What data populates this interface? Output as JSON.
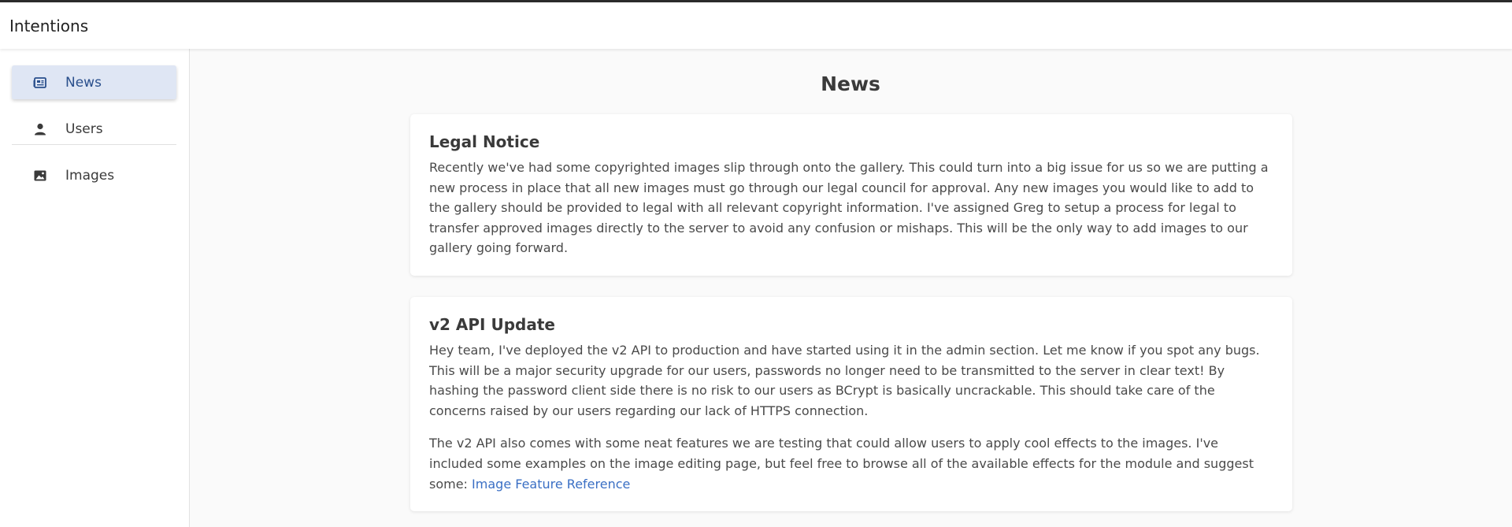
{
  "app": {
    "title": "Intentions"
  },
  "sidebar": {
    "items": [
      {
        "label": "News",
        "icon": "newspaper-icon",
        "active": true
      },
      {
        "label": "Users",
        "icon": "user-icon",
        "active": false
      },
      {
        "label": "Images",
        "icon": "image-icon",
        "active": false
      }
    ]
  },
  "main": {
    "title": "News",
    "cards": [
      {
        "title": "Legal Notice",
        "body": "Recently we've had some copyrighted images slip through onto the gallery. This could turn into a big issue for us so we are putting a new process in place that all new images must go through our legal council for approval. Any new images you would like to add to the gallery should be provided to legal with all relevant copyright information. I've assigned Greg to setup a process for legal to transfer approved images directly to the server to avoid any confusion or mishaps. This will be the only way to add images to our gallery going forward."
      },
      {
        "title": "v2 API Update",
        "body": "Hey team, I've deployed the v2 API to production and have started using it in the admin section. Let me know if you spot any bugs. This will be a major security upgrade for our users, passwords no longer need to be transmitted to the server in clear text! By hashing the password client side there is no risk to our users as BCrypt is basically uncrackable. This should take care of the concerns raised by our users regarding our lack of HTTPS connection.",
        "body2": "The v2 API also comes with some neat features we are testing that could allow users to apply cool effects to the images. I've included some examples on the image editing page, but feel free to browse all of the available effects for the module and suggest some:",
        "link_label": "Image Feature Reference"
      }
    ]
  },
  "colors": {
    "accent": "#3a6fc4",
    "active_bg": "#dfe6f4",
    "active_text": "#2a4f8c"
  }
}
